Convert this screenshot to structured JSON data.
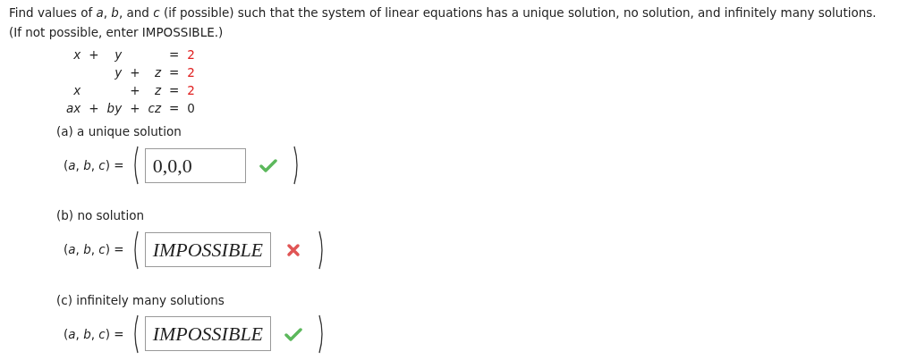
{
  "question": {
    "prompt": "Find values of *a*, *b*, and *c* (if possible) such that the system of linear equations has a unique solution, no solution, and infinitely many solutions. (If not possible, enter IMPOSSIBLE.)"
  },
  "equations": [
    {
      "x_term": "x",
      "plus_1": "+",
      "y_term": "y",
      "equals": "=",
      "rhs": "2",
      "rhs_highlighted": true
    },
    {
      "y_term": "y",
      "plus_2": "+",
      "z_term": "z",
      "equals": "=",
      "rhs": "2",
      "rhs_highlighted": true
    },
    {
      "x_term": "x",
      "plus_2": "+",
      "z_term": "z",
      "equals": "=",
      "rhs": "2",
      "rhs_highlighted": true
    },
    {
      "x_term": "ax",
      "plus_1": "+",
      "y_term": "by",
      "plus_2": "+",
      "z_term": "cz",
      "equals": "=",
      "rhs": "0",
      "rhs_highlighted": false
    }
  ],
  "parts": [
    {
      "label": "(a) a unique solution",
      "prefix": "(*a*, *b*, *c*) =",
      "answer": "0,0,0",
      "kind": "number",
      "correct": true
    },
    {
      "label": "(b) no solution",
      "prefix": "(*a*, *b*, *c*) =",
      "answer": "IMPOSSIBLE",
      "kind": "word",
      "correct": false
    },
    {
      "label": "(c) infinitely many solutions",
      "prefix": "(*a*, *b*, *c*) =",
      "answer": "IMPOSSIBLE",
      "kind": "word",
      "correct": true
    }
  ]
}
